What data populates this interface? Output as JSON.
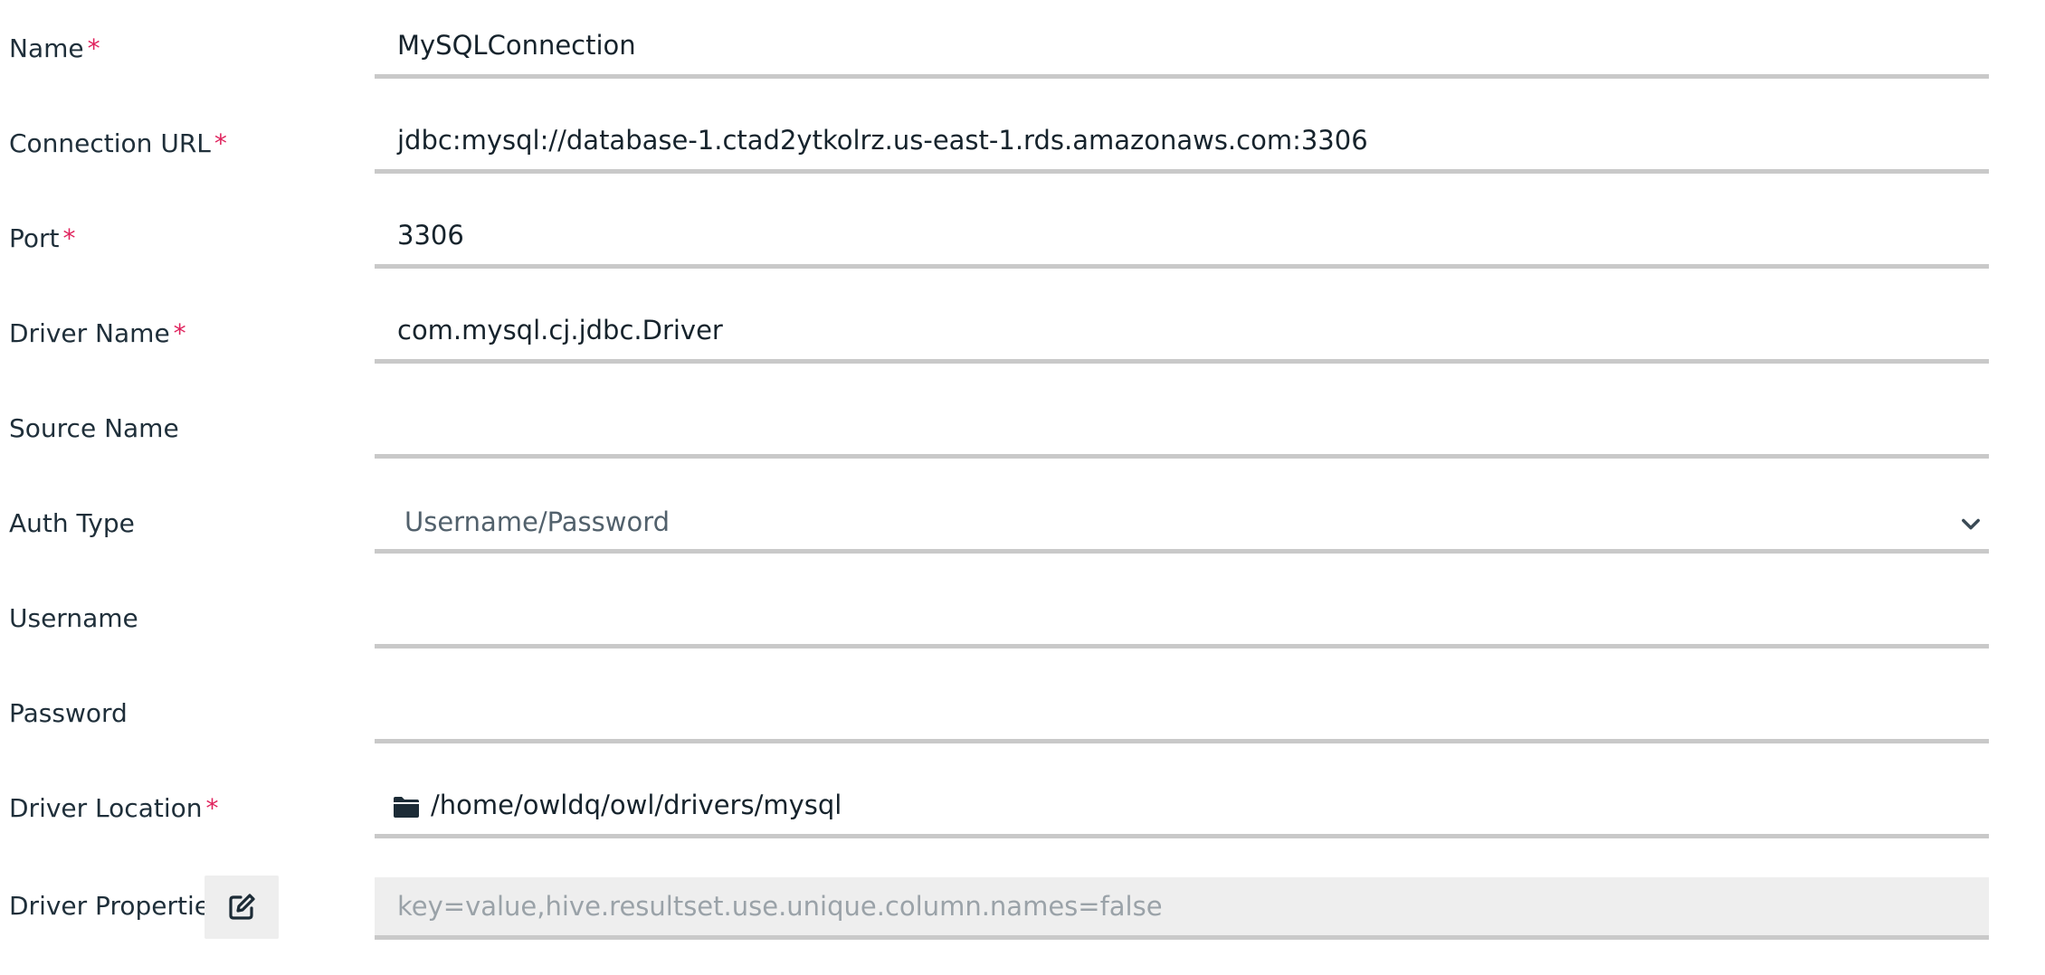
{
  "required_marker": "*",
  "fields": {
    "name": {
      "label": "Name",
      "value": "MySQLConnection"
    },
    "connection_url": {
      "label": "Connection URL",
      "value": "jdbc:mysql://database-1.ctad2ytkolrz.us-east-1.rds.amazonaws.com:3306"
    },
    "port": {
      "label": "Port",
      "value": "3306"
    },
    "driver_name": {
      "label": "Driver Name",
      "value": "com.mysql.cj.jdbc.Driver"
    },
    "source_name": {
      "label": "Source Name",
      "value": ""
    },
    "auth_type": {
      "label": "Auth Type",
      "value": "Username/Password"
    },
    "username": {
      "label": "Username",
      "value": ""
    },
    "password": {
      "label": "Password",
      "value": ""
    },
    "driver_location": {
      "label": "Driver Location",
      "value": "/home/owldq/owl/drivers/mysql",
      "icon": "folder-icon"
    },
    "driver_properties": {
      "label": "Driver Properties",
      "placeholder": "key=value,hive.resultset.use.unique.column.names=false",
      "icon": "edit-icon"
    }
  },
  "colors": {
    "required": "#e0245e",
    "underline": "#c9c9c9",
    "disabled_bg": "#eeeeee",
    "text": "#16232c",
    "icon": "#1c2b36"
  }
}
